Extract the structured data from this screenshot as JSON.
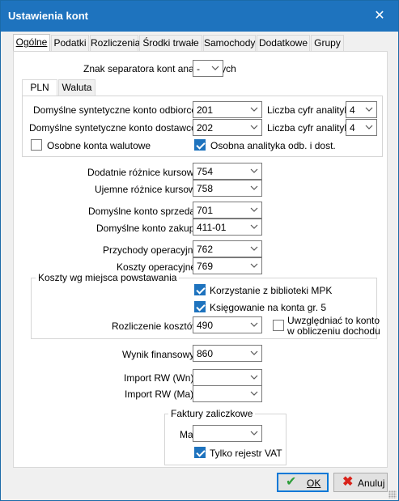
{
  "window": {
    "title": "Ustawienia kont",
    "close_label": "✕"
  },
  "tabs": [
    "Ogólne",
    "Podatki",
    "Rozliczenia",
    "Środki trwałe",
    "Samochody",
    "Dodatkowe",
    "Grupy"
  ],
  "active_tab": "Ogólne",
  "separator": {
    "label": "Znak separatora kont analitycznych",
    "value": "-"
  },
  "currency_tabs": [
    "PLN",
    "Waluta"
  ],
  "pln": {
    "receivables_label": "Domyślne syntetyczne konto odbiorców",
    "receivables_value": "201",
    "suppliers_label": "Domyślne syntetyczne konto dostawców",
    "suppliers_value": "202",
    "digits_label_1": "Liczba cyfr analityki",
    "digits_value_1": "4",
    "digits_label_2": "Liczba cyfr analityki",
    "digits_value_2": "4",
    "separate_currency_label": "Osobne konta walutowe",
    "separate_currency_checked": false,
    "separate_analytics_label": "Osobna analityka odb. i dost.",
    "separate_analytics_checked": true
  },
  "exchange": {
    "pos_label": "Dodatnie różnice kursowe",
    "pos_value": "754",
    "neg_label": "Ujemne różnice kursowe",
    "neg_value": "758"
  },
  "sales": {
    "sale_label": "Domyślne konto sprzedaży",
    "sale_value": "701",
    "purchase_label": "Domyślne konto zakupu",
    "purchase_value": "411-01"
  },
  "operating": {
    "income_label": "Przychody operacyjne",
    "income_value": "762",
    "costs_label": "Koszty operacyjne",
    "costs_value": "769"
  },
  "mpk": {
    "group_title": "Koszty wg miejsca powstawania",
    "use_library_label": "Korzystanie z biblioteki MPK",
    "use_library_checked": true,
    "posting_label": "Księgowanie na konta gr. 5",
    "posting_checked": true,
    "settlement_label": "Rozliczenie kosztów",
    "settlement_value": "490",
    "income_line1": "Uwzględniać to konto",
    "income_line2": "w obliczeniu dochodu",
    "income_checked": false
  },
  "result": {
    "label": "Wynik finansowy",
    "value": "860"
  },
  "import": {
    "wn_label": "Import RW (Wn)",
    "wn_value": "",
    "ma_label": "Import RW (Ma)",
    "ma_value": ""
  },
  "advance": {
    "group_title": "Faktury zaliczkowe",
    "ma_label": "Ma",
    "ma_value": "",
    "vat_label": "Tylko rejestr VAT",
    "vat_checked": true
  },
  "buttons": {
    "ok_label": "OK",
    "cancel_label": "Anuluj"
  },
  "colors": {
    "accent": "#1e73be",
    "ok_icon": "#2e9e3a",
    "cancel_icon": "#d9231b"
  }
}
